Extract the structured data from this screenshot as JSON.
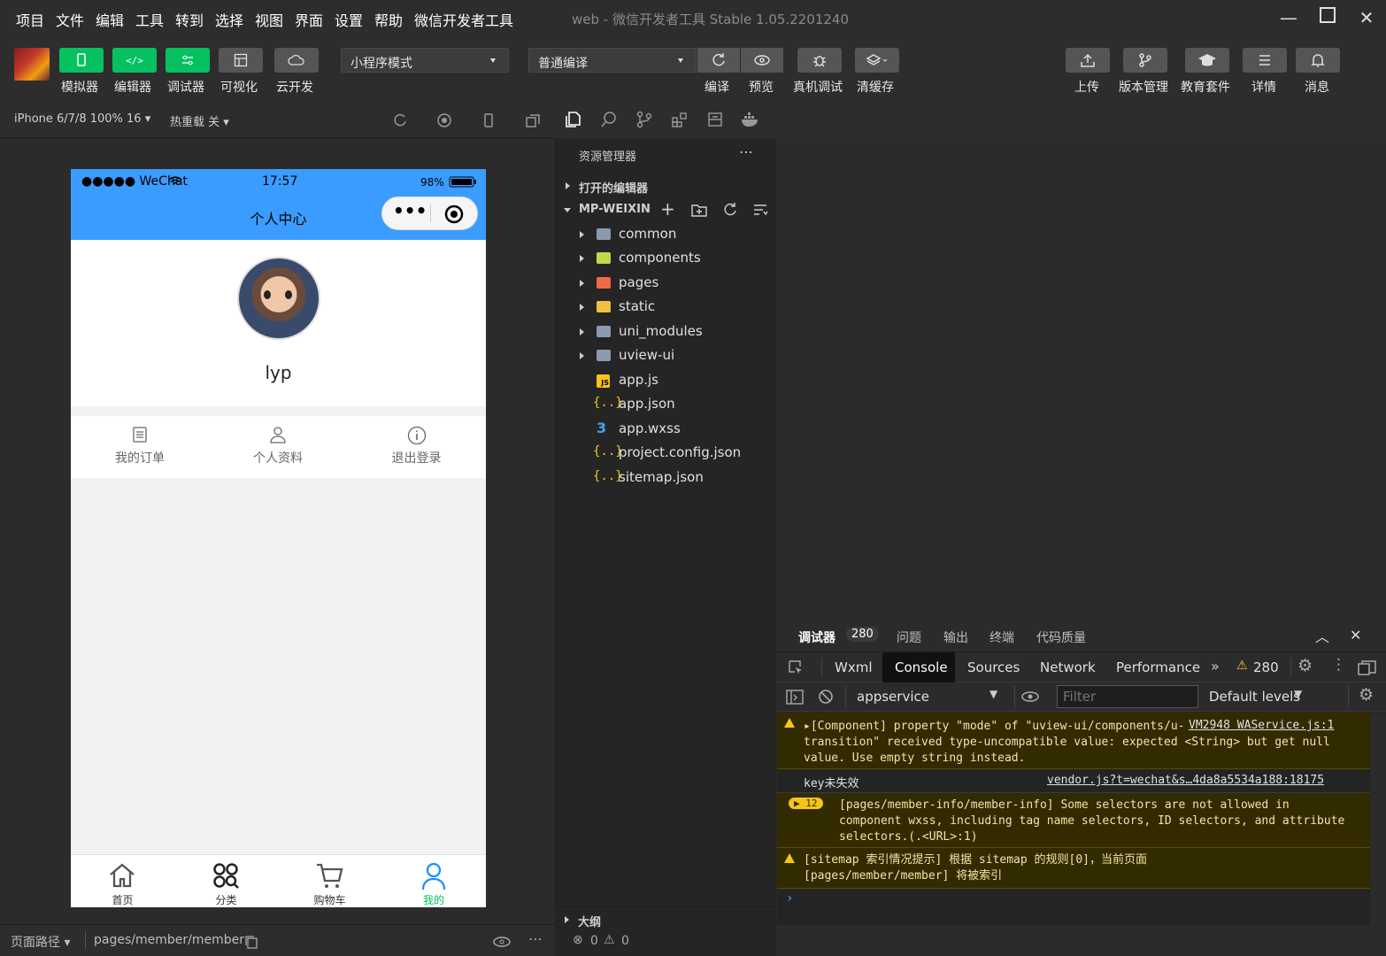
{
  "menu": [
    "项目",
    "文件",
    "编辑",
    "工具",
    "转到",
    "选择",
    "视图",
    "界面",
    "设置",
    "帮助",
    "微信开发者工具"
  ],
  "window": {
    "title": "web - 微信开发者工具 Stable 1.05.2201240"
  },
  "toolbar": {
    "left_buttons": [
      "模拟器",
      "编辑器",
      "调试器",
      "可视化",
      "云开发"
    ],
    "mode_select": "小程序模式",
    "compile_select": "普通编译",
    "mid_buttons": [
      "编译",
      "预览",
      "真机调试",
      "清缓存"
    ],
    "right_buttons": [
      "上传",
      "版本管理",
      "教育套件",
      "详情",
      "消息"
    ]
  },
  "simulator": {
    "device": "iPhone 6/7/8 100% 16",
    "hot_reload": "热重载 关",
    "status_carrier": "●●●●● WeChat",
    "status_time": "17:57",
    "status_battery": "98%",
    "nav_title": "个人中心",
    "username": "lyp",
    "actions": [
      "我的订单",
      "个人资料",
      "退出登录"
    ],
    "tabbar": [
      "首页",
      "分类",
      "购物车",
      "我的"
    ],
    "page_path_label": "页面路径",
    "page_path": "pages/member/member"
  },
  "explorer": {
    "title": "资源管理器",
    "open_editors": "打开的编辑器",
    "project": "MP-WEIXIN",
    "folders": [
      "common",
      "components",
      "pages",
      "static",
      "uni_modules",
      "uview-ui"
    ],
    "files": [
      "app.js",
      "app.json",
      "app.wxss",
      "project.config.json",
      "sitemap.json"
    ],
    "outline": "大纲",
    "errors": "0",
    "warnings": "0"
  },
  "devtools": {
    "tabs": [
      "调试器",
      "问题",
      "输出",
      "终端",
      "代码质量"
    ],
    "debugger_badge": "280",
    "panels": [
      "Wxml",
      "Console",
      "Sources",
      "Network",
      "Performance"
    ],
    "warn_count": "280",
    "context": "appservice",
    "filter_placeholder": "Filter",
    "levels": "Default levels",
    "logs": {
      "log1_text": "▸[Component] property \"mode\" of \"uview-ui/components/u-transition/u-transition\" received type-uncompatible value: expected <String> but get null value. Use empty string instead.",
      "log1_src": "VM2948 WAService.js:1",
      "log2_text": "key未失效",
      "log2_src": "vendor.js?t=wechat&s…4da8a5534a188:18175",
      "log3_badge": "▶ 12",
      "log3_text": "[pages/member-info/member-info] Some selectors are not allowed in component wxss, including tag name selectors, ID selectors, and attribute selectors.(.<URL>:1)",
      "log4_text": "[sitemap 索引情况提示] 根据 sitemap 的规则[0]，当前页面 [pages/member/member] 将被索引"
    }
  },
  "colors": {
    "accent_green": "#07c160",
    "nav_blue": "#3b9cff",
    "tab_active": "#07c160"
  }
}
